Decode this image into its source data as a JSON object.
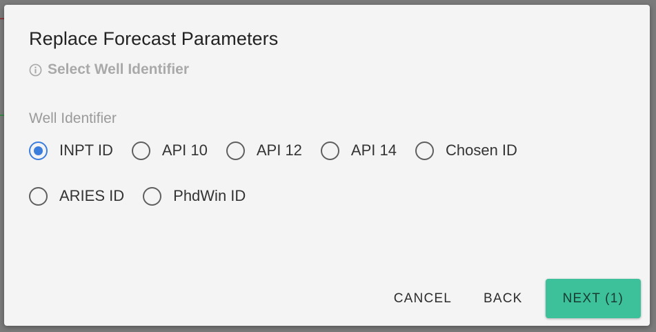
{
  "dialog": {
    "title": "Replace Forecast Parameters",
    "subtitle": "Select Well Identifier",
    "field_label": "Well Identifier",
    "options_row1": [
      {
        "label": "INPT ID",
        "checked": true
      },
      {
        "label": "API 10",
        "checked": false
      },
      {
        "label": "API 12",
        "checked": false
      },
      {
        "label": "API 14",
        "checked": false
      },
      {
        "label": "Chosen ID",
        "checked": false
      }
    ],
    "options_row2": [
      {
        "label": "ARIES ID",
        "checked": false
      },
      {
        "label": "PhdWin ID",
        "checked": false
      }
    ],
    "actions": {
      "cancel": "CANCEL",
      "back": "BACK",
      "next": "NEXT (1)"
    }
  },
  "colors": {
    "accent": "#3b7ddd",
    "primary_button": "#3cc19a",
    "backdrop": "#7b7b7b",
    "dialog_bg": "#f4f4f4"
  },
  "icons": {
    "subtitle_icon": "info-icon"
  }
}
